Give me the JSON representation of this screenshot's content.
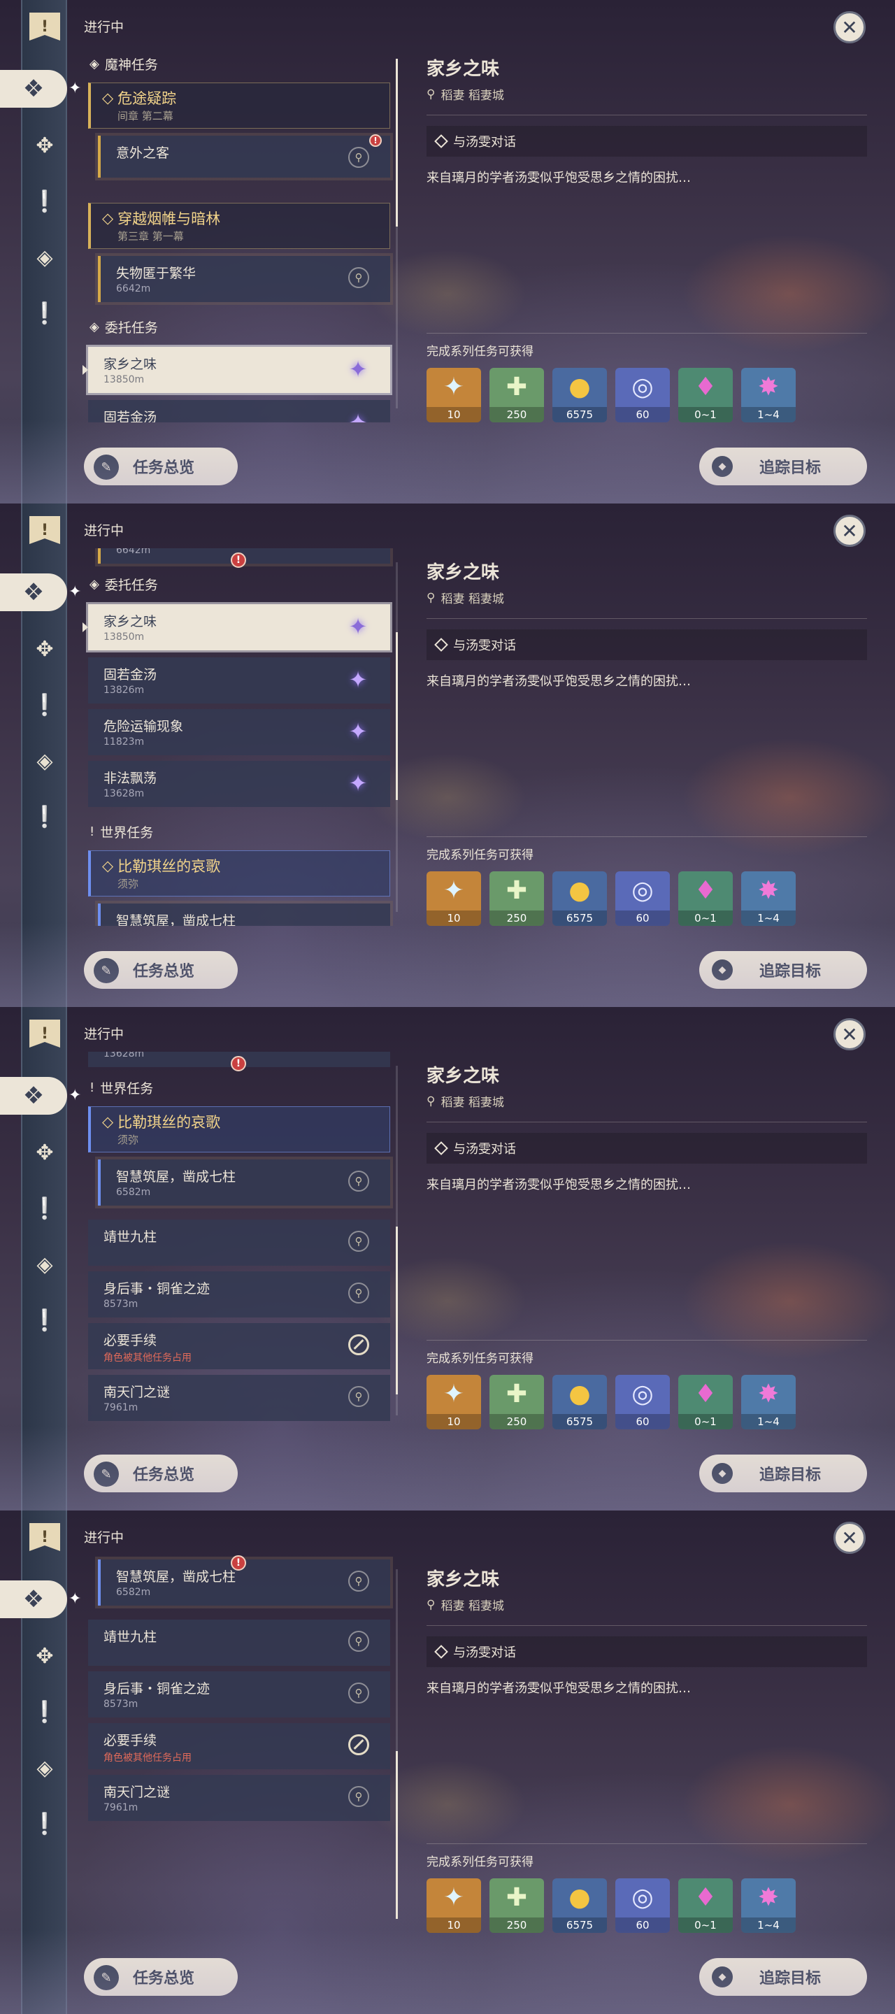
{
  "colors": {
    "gold": "#d8b25a",
    "blue": "#6e8ff0",
    "cream": "#ece5d8",
    "dark": "#3b4256"
  },
  "header": {
    "progress_label": "进行中",
    "close_symbol": "✕"
  },
  "sidebar": {
    "top_icon": "bookmark-icon",
    "icons": [
      "archon-icon",
      "story-icon",
      "world-icon",
      "commission-icon",
      "world-icon"
    ]
  },
  "sections": {
    "archon": {
      "title": "魔神任务",
      "icon": "archon-icon"
    },
    "commission": {
      "title": "委托任务",
      "icon": "commission-icon"
    },
    "world": {
      "title": "世界任务",
      "icon": "exclamation-icon"
    }
  },
  "archon": {
    "chapter1": {
      "title": "危途疑踪",
      "sub": "间章 第二幕"
    },
    "quest1": {
      "title": "意外之客"
    },
    "chapter2": {
      "title": "穿越烟帷与暗林",
      "sub": "第三章 第一幕"
    },
    "quest2": {
      "title": "失物匿于繁华",
      "distance": "6642m"
    }
  },
  "commissions": [
    {
      "title": "家乡之味",
      "distance": "13850m"
    },
    {
      "title": "固若金汤",
      "distance": "13826m"
    },
    {
      "title": "危险运输现象",
      "distance": "11823m"
    },
    {
      "title": "非法飘荡",
      "distance": "13628m"
    }
  ],
  "world": {
    "chapter": {
      "title": "比勒琪丝的哀歌",
      "sub": "须弥"
    },
    "quests": [
      {
        "title": "智慧筑屋，凿成七柱",
        "distance": "6582m"
      },
      {
        "title": "靖世九柱",
        "distance": ""
      },
      {
        "title": "身后事・铜雀之迹",
        "distance": "8573m"
      },
      {
        "title": "必要手续",
        "note": "角色被其他任务占用"
      },
      {
        "title": "南天门之谜",
        "distance": "7961m"
      }
    ]
  },
  "detail": {
    "title": "家乡之味",
    "location": "稻妻 稻妻城",
    "objective": "与汤雯对话",
    "description": "来自璃月的学者汤雯似乎饱受思乡之情的困扰…",
    "reward_label": "完成系列任务可获得",
    "rewards": [
      {
        "name": "primogem-icon",
        "count": "10",
        "bg": "#c4853a"
      },
      {
        "name": "adventure-exp-icon",
        "count": "250",
        "bg": "#6a9a6a"
      },
      {
        "name": "mora-icon",
        "count": "6575",
        "bg": "#4a6aa0"
      },
      {
        "name": "companionship-exp-icon",
        "count": "60",
        "bg": "#5a6ab8"
      },
      {
        "name": "enhancement-ore-icon",
        "count": "0~1",
        "bg": "#4e8a72"
      },
      {
        "name": "crystal-ore-icon",
        "count": "1~4",
        "bg": "#4f7aa8"
      }
    ]
  },
  "buttons": {
    "overview": "任务总览",
    "track": "追踪目标"
  },
  "alert_symbol": "!"
}
